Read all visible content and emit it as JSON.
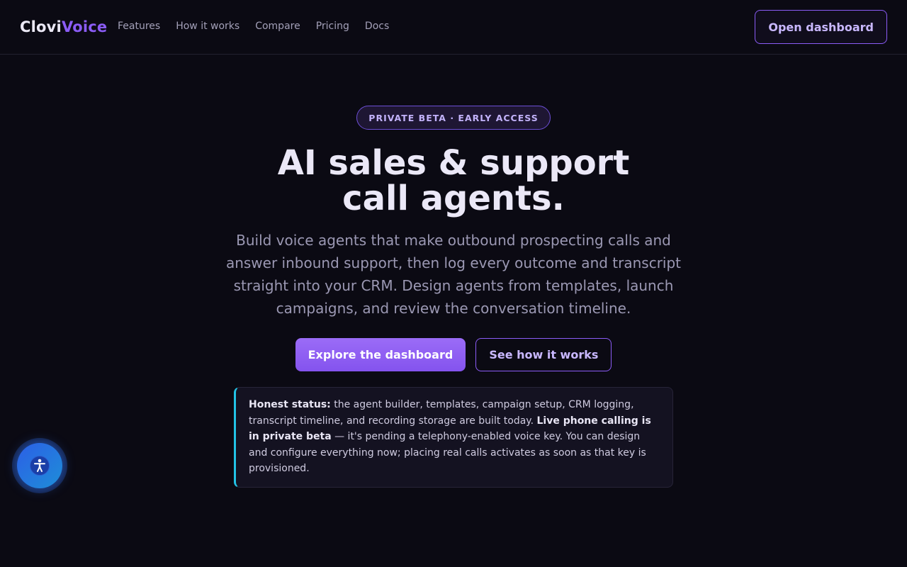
{
  "brand": {
    "part1": "Clovi",
    "part2": "Voice"
  },
  "nav": {
    "links": [
      "Features",
      "How it works",
      "Compare",
      "Pricing",
      "Docs"
    ],
    "cta": "Open dashboard"
  },
  "hero": {
    "badge": "PRIVATE BETA · EARLY ACCESS",
    "title_line1": "AI sales & support",
    "title_line2": "call agents.",
    "subtitle": "Build voice agents that make outbound prospecting calls and answer inbound support, then log every outcome and transcript straight into your CRM. Design agents from templates, launch campaigns, and review the conversation timeline.",
    "primary_button": "Explore the dashboard",
    "secondary_button": "See how it works"
  },
  "status": {
    "label": "Honest status:",
    "text1": " the agent builder, templates, campaign setup, CRM logging, transcript timeline, and recording storage are built today. ",
    "emphasis": "Live phone calling is in private beta",
    "text2": " — it's pending a telephony-enabled voice key. You can design and configure everything now; placing real calls activates as soon as that key is provisioned."
  },
  "icons": {
    "accessibility": "accessibility-icon"
  },
  "colors": {
    "accent": "#8b5cf6",
    "background": "#0b0a13",
    "status_border": "#22c3e6"
  }
}
